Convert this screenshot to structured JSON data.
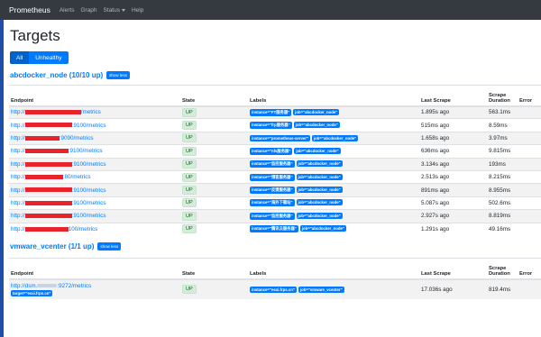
{
  "navbar": {
    "brand": "Prometheus",
    "links": [
      "Alerts",
      "Graph",
      "Status",
      "Help"
    ]
  },
  "page": {
    "title": "Targets",
    "filter_all": "All",
    "filter_unhealthy": "Unhealthy"
  },
  "columns": {
    "endpoint": "Endpoint",
    "state": "State",
    "labels": "Labels",
    "last_scrape": "Last Scrape",
    "scrape_duration": "Scrape Duration",
    "error": "Error"
  },
  "jobs": [
    {
      "title": "abcdocker_node (10/10 up)",
      "show_less": "show less",
      "rows": [
        {
          "ep_pre": "http://",
          "ep_post": "/metrics",
          "state": "UP",
          "instance": "instance=\"FT服务器\"",
          "job": "job=\"abcdocker_node\"",
          "last": "1.895s ago",
          "dur": "563.1ms"
        },
        {
          "ep_pre": "http://",
          "ep_post": ":9100/metrics",
          "state": "UP",
          "instance": "instance=\"frp服务器\"",
          "job": "job=\"abcdocker_node\"",
          "last": "515ms ago",
          "dur": "8.59ms"
        },
        {
          "ep_pre": "http://",
          "ep_post": ":9090/metrics",
          "state": "UP",
          "instance": "instance=\"prometheus-server\"",
          "job": "job=\"abcdocker_node\"",
          "last": "1.658s ago",
          "dur": "3.97ms"
        },
        {
          "ep_pre": "http://",
          "ep_post": ":9100/metrics",
          "state": "UP",
          "instance": "instance=\"nfs服务器\"",
          "job": "job=\"abcdocker_node\"",
          "last": "636ms ago",
          "dur": "9.815ms"
        },
        {
          "ep_pre": "http://",
          "ep_post": ":9100/metrics",
          "state": "UP",
          "instance": "instance=\"监控服务器\"",
          "job": "job=\"abcdocker_node\"",
          "last": "3.134s ago",
          "dur": "193ms"
        },
        {
          "ep_pre": "http://",
          "ep_post": ":80/metrics",
          "state": "UP",
          "instance": "instance=\"博客服务器\"",
          "job": "job=\"abcdocker_node\"",
          "last": "2.513s ago",
          "dur": "8.215ms"
        },
        {
          "ep_pre": "http://",
          "ep_post": ":9100/metrics",
          "state": "UP",
          "instance": "instance=\"反馈服务器\"",
          "job": "job=\"abcdocker_node\"",
          "last": "891ms ago",
          "dur": "8.955ms"
        },
        {
          "ep_pre": "http://",
          "ep_post": ":9100/metrics",
          "state": "UP",
          "instance": "instance=\"海外下载站\"",
          "job": "job=\"abcdocker_node\"",
          "last": "5.087s ago",
          "dur": "502.6ms"
        },
        {
          "ep_pre": "http://",
          "ep_post": ":9100/metrics",
          "state": "UP",
          "instance": "instance=\"监控服务器\"",
          "job": "job=\"abcdocker_node\"",
          "last": "2.927s ago",
          "dur": "8.819ms"
        },
        {
          "ep_pre": "http://",
          "ep_post": "100/metrics",
          "state": "UP",
          "instance": "instance=\"腾讯云服务器\"",
          "job": "job=\"abcdocker_node\"",
          "last": "1.291s ago",
          "dur": "49.16ms"
        }
      ]
    },
    {
      "title": "vmware_vcenter (1/1 up)",
      "show_less": "show less",
      "rows": [
        {
          "ep_pre": "http://dsm.",
          "ep_post": ":9272/metrics",
          "state": "UP",
          "instance": "instance=\"esxi.frps.cn\"",
          "job": "job=\"vmware_vcenter\"",
          "last": "17.036s ago",
          "dur": "819.4ms",
          "target": "target=\"esxi.frps.cn\""
        }
      ]
    }
  ],
  "colors": {
    "navbar": "#343a40",
    "link": "#007bff",
    "redaction": "#e8232b"
  }
}
